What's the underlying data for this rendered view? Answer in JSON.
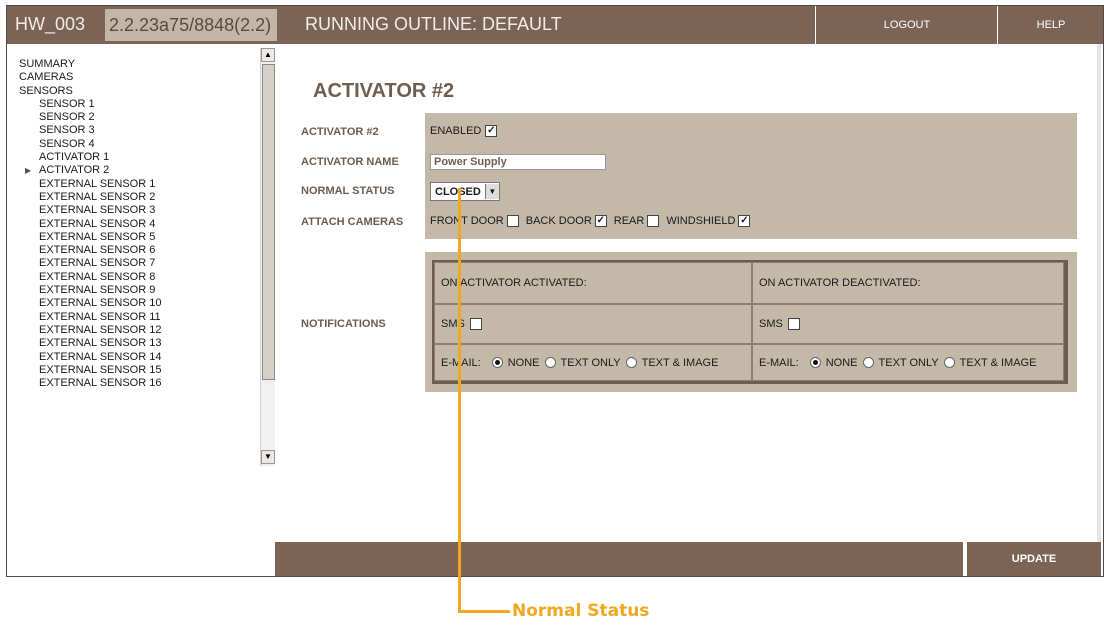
{
  "topbar": {
    "host": "HW_003",
    "version": "2.2.23a75/8848(2.2)",
    "outline": "RUNNING OUTLINE: DEFAULT",
    "logout": "LOGOUT",
    "help": "HELP"
  },
  "sidebar": {
    "items": [
      {
        "label": "SUMMARY",
        "level": 0,
        "expanded": false
      },
      {
        "label": "CAMERAS",
        "level": 0,
        "expanded": false
      },
      {
        "label": "SENSORS",
        "level": 0,
        "expanded": true
      },
      {
        "label": "SENSOR 1",
        "level": 1
      },
      {
        "label": "SENSOR 2",
        "level": 1
      },
      {
        "label": "SENSOR 3",
        "level": 1
      },
      {
        "label": "SENSOR 4",
        "level": 1
      },
      {
        "label": "ACTIVATOR 1",
        "level": 1
      },
      {
        "label": "ACTIVATOR 2",
        "level": 1,
        "expanded": true
      },
      {
        "label": "EXTERNAL SENSOR 1",
        "level": 1
      },
      {
        "label": "EXTERNAL SENSOR 2",
        "level": 1
      },
      {
        "label": "EXTERNAL SENSOR 3",
        "level": 1
      },
      {
        "label": "EXTERNAL SENSOR 4",
        "level": 1
      },
      {
        "label": "EXTERNAL SENSOR 5",
        "level": 1
      },
      {
        "label": "EXTERNAL SENSOR 6",
        "level": 1
      },
      {
        "label": "EXTERNAL SENSOR 7",
        "level": 1
      },
      {
        "label": "EXTERNAL SENSOR 8",
        "level": 1
      },
      {
        "label": "EXTERNAL SENSOR 9",
        "level": 1
      },
      {
        "label": "EXTERNAL SENSOR 10",
        "level": 1
      },
      {
        "label": "EXTERNAL SENSOR 11",
        "level": 1
      },
      {
        "label": "EXTERNAL SENSOR 12",
        "level": 1
      },
      {
        "label": "EXTERNAL SENSOR 13",
        "level": 1
      },
      {
        "label": "EXTERNAL SENSOR 14",
        "level": 1
      },
      {
        "label": "EXTERNAL SENSOR 15",
        "level": 1
      },
      {
        "label": "EXTERNAL SENSOR 16",
        "level": 1
      }
    ]
  },
  "main": {
    "title": "ACTIVATOR #2",
    "labels": {
      "activator": "ACTIVATOR #2",
      "name": "ACTIVATOR NAME",
      "normal_status": "NORMAL STATUS",
      "attach_cameras": "ATTACH CAMERAS",
      "notifications": "NOTIFICATIONS"
    },
    "enabled": {
      "label": "ENABLED",
      "checked": true
    },
    "name_value": "Power Supply",
    "normal_status_value": "CLOSED",
    "cameras": [
      {
        "label": "FRONT DOOR",
        "checked": false
      },
      {
        "label": "BACK DOOR",
        "checked": true
      },
      {
        "label": "REAR",
        "checked": false
      },
      {
        "label": "WINDSHIELD",
        "checked": true
      }
    ],
    "notifications": {
      "activated_header": "ON ACTIVATOR ACTIVATED:",
      "deactivated_header": "ON ACTIVATOR DEACTIVATED:",
      "sms_label": "SMS",
      "email_label": "E-MAIL:",
      "options": [
        "NONE",
        "TEXT ONLY",
        "TEXT & IMAGE"
      ],
      "activated": {
        "sms": false,
        "email": "NONE"
      },
      "deactivated": {
        "sms": false,
        "email": "NONE"
      }
    },
    "update": "UPDATE"
  },
  "callout": {
    "text": "Normal Status",
    "color": "#f2a81d"
  },
  "colors": {
    "brand": "#7b6456",
    "panel": "#c4b8a9"
  }
}
